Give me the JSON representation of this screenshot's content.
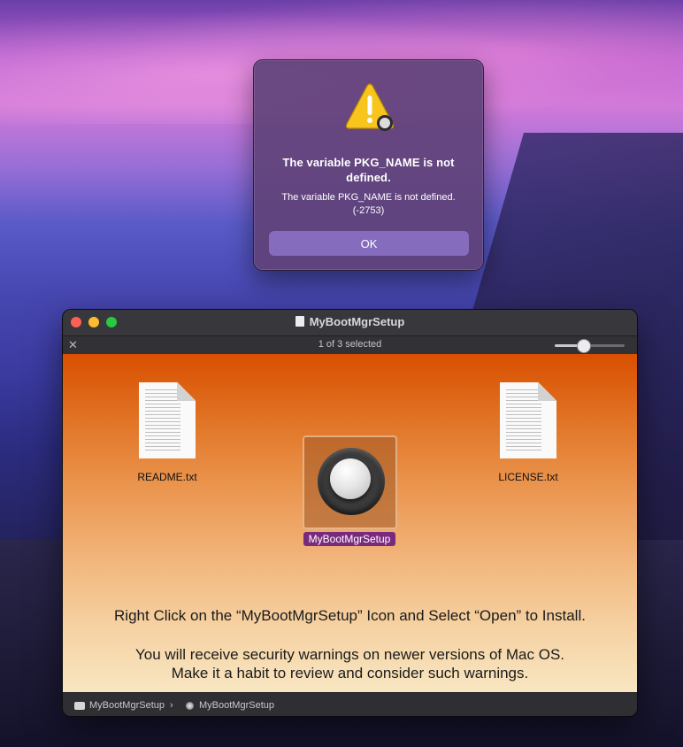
{
  "alert": {
    "title": "The variable PKG_NAME is not defined.",
    "message": "The variable PKG_NAME is not defined. (-2753)",
    "button_label": "OK",
    "icon": "warning-triangle-icon"
  },
  "finder": {
    "window_title": "MyBootMgrSetup",
    "status": "1 of 3 selected",
    "icon_size_slider": 0.4,
    "files": [
      {
        "name": "README.txt",
        "icon": "text-document-icon"
      },
      {
        "name": "MyBootMgrSetup",
        "icon": "installer-app-icon",
        "selected": true
      },
      {
        "name": "LICENSE.txt",
        "icon": "text-document-icon"
      }
    ],
    "instructions": {
      "line1": "Right Click on the “MyBootMgrSetup” Icon and Select “Open” to Install.",
      "line2": "You will receive security warnings on newer versions of Mac OS.",
      "line3": "Make it a habit to review and consider such warnings."
    },
    "path": [
      "MyBootMgrSetup",
      "MyBootMgrSetup"
    ]
  },
  "colors": {
    "close": "#fe5f57",
    "minimize": "#febc2e",
    "zoom": "#28c840",
    "selection_label": "#7a2a7e"
  }
}
